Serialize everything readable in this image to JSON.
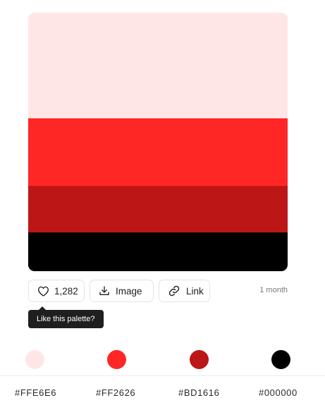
{
  "palette": {
    "colors": [
      {
        "hex": "#FFE6E6",
        "label": "#FFE6E6"
      },
      {
        "hex": "#FF2626",
        "label": "#FF2626"
      },
      {
        "hex": "#BD1616",
        "label": "#BD1616"
      },
      {
        "hex": "#000000",
        "label": "#000000"
      }
    ]
  },
  "actions": {
    "like_count": "1,282",
    "image_label": "Image",
    "link_label": "Link",
    "time_ago": "1 month"
  },
  "tooltip": {
    "text": "Like this palette?"
  }
}
